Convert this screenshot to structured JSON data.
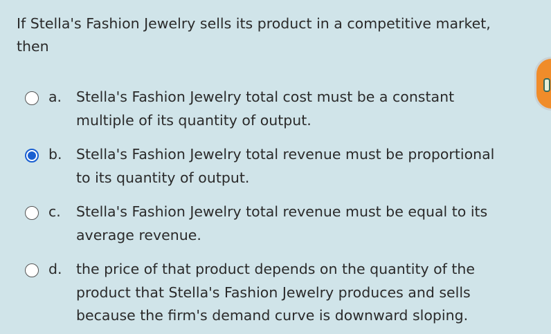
{
  "question": {
    "line1": "If Stella's Fashion Jewelry sells its product in a competitive market,",
    "line2": "then"
  },
  "options": [
    {
      "letter": "a.",
      "line1": "Stella's Fashion Jewelry total cost must be a constant",
      "line2": "multiple of its quantity of output.",
      "selected": false
    },
    {
      "letter": "b.",
      "line1": "Stella's Fashion Jewelry total revenue must be proportional",
      "line2": "to its quantity of output.",
      "selected": true
    },
    {
      "letter": "c.",
      "line1": "Stella's Fashion Jewelry total revenue must be equal to its",
      "line2": "average revenue.",
      "selected": false
    },
    {
      "letter": "d.",
      "line1": "the price of that product depends on the quantity of the",
      "line2": "product that Stella's Fashion Jewelry produces and sells",
      "line3": "because the firm's demand curve is downward sloping.",
      "selected": false
    }
  ],
  "colors": {
    "background": "#d0e4e9",
    "selected_radio": "#1a5fd1",
    "side_widget": "#f08c2a"
  }
}
